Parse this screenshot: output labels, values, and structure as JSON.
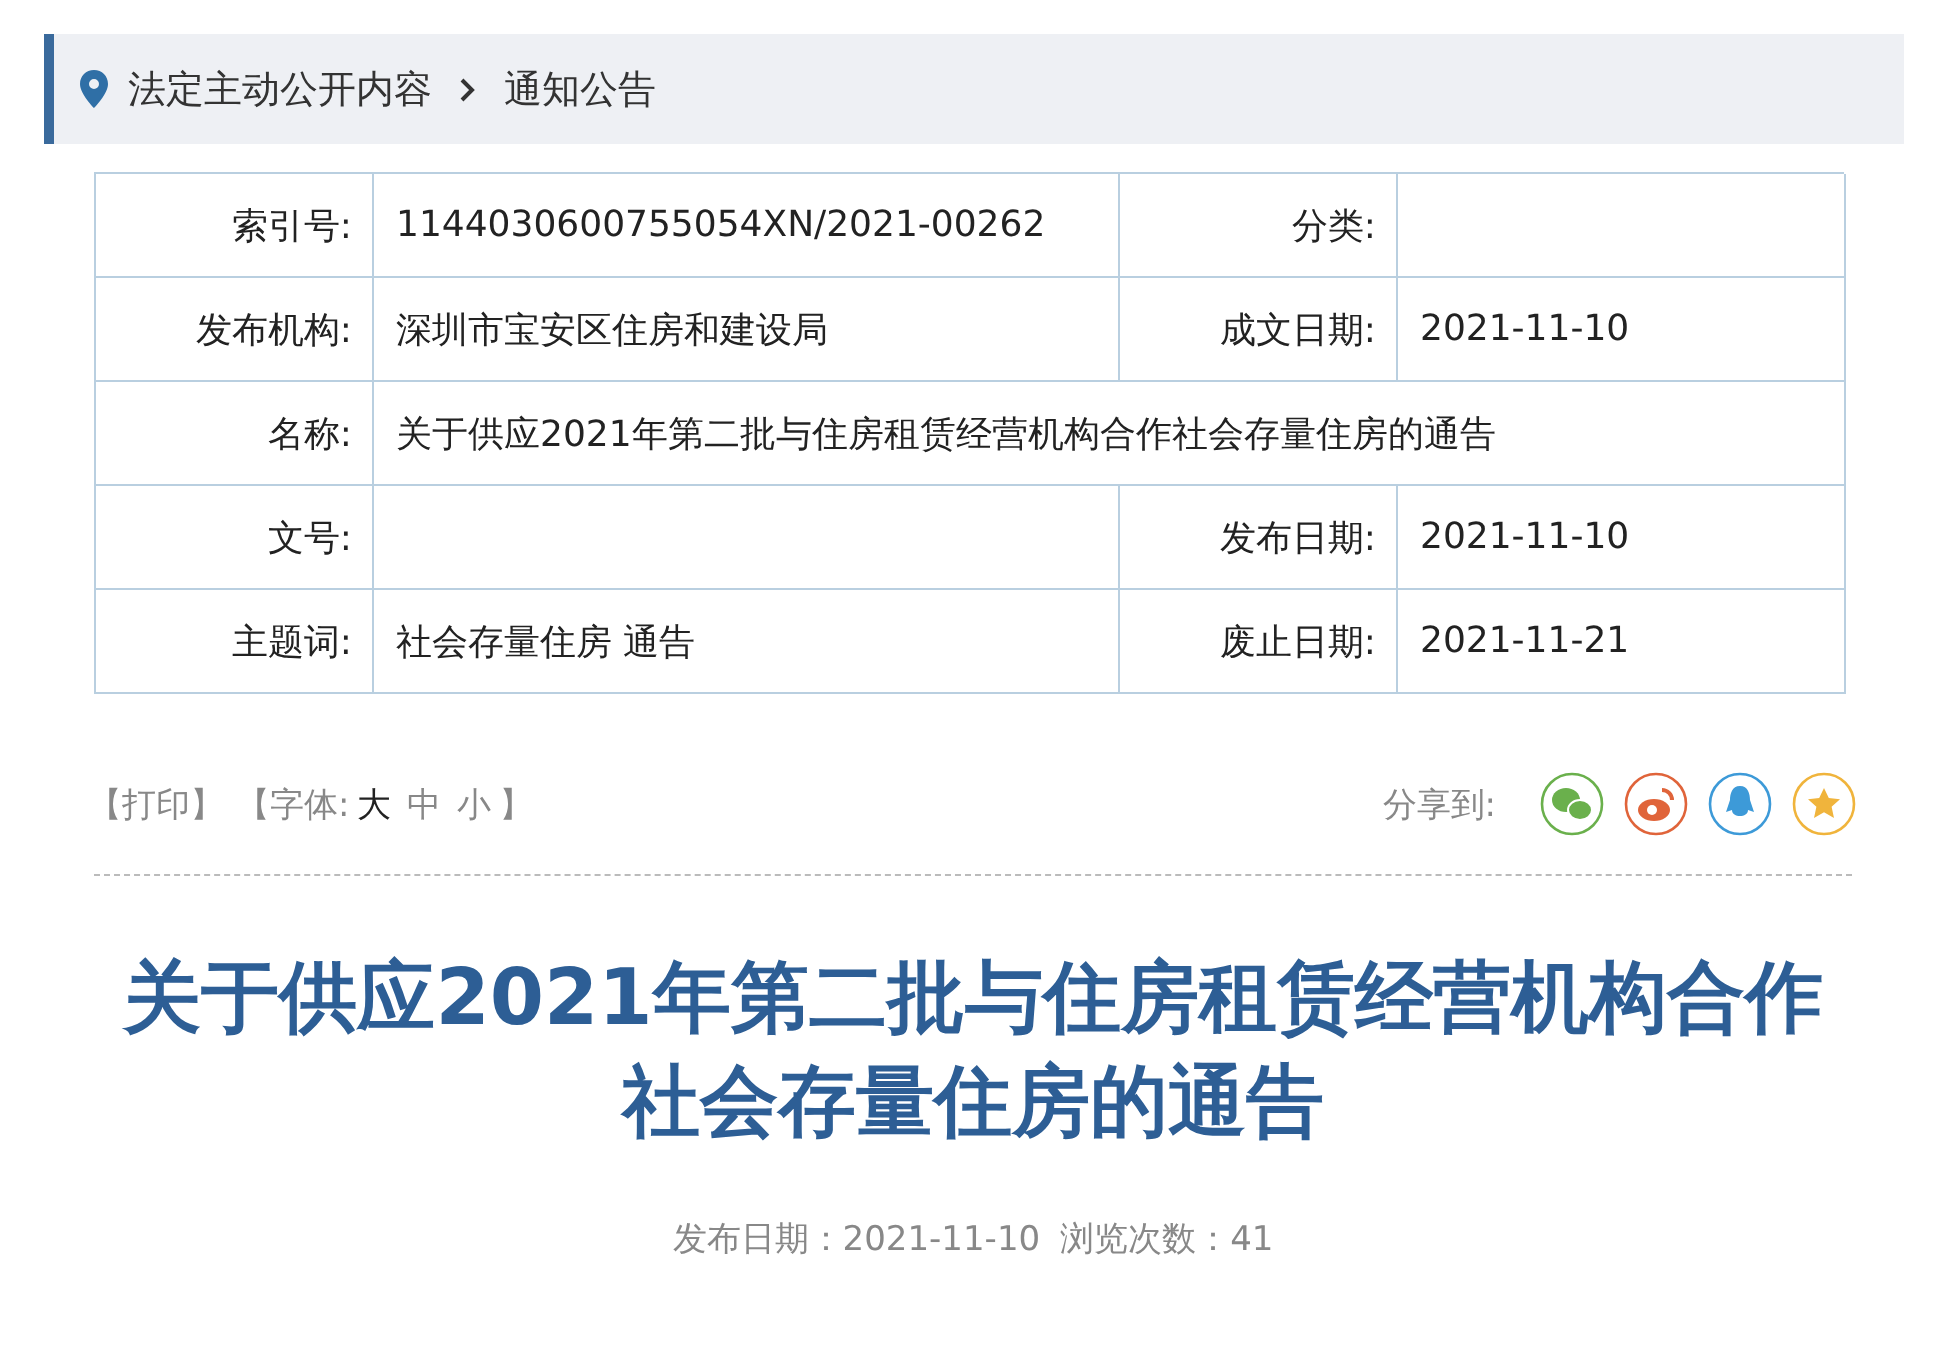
{
  "breadcrumb": {
    "items": [
      "法定主动公开内容",
      "通知公告"
    ]
  },
  "info_table": {
    "rows": [
      {
        "cells": [
          {
            "label": "索引号:",
            "value": "1144030600755054XN/2021-00262"
          },
          {
            "label": "分类:"
          }
        ]
      },
      {
        "cells": [
          {
            "label": "发布机构:",
            "value": "深圳市宝安区住房和建设局"
          },
          {
            "label": "成文日期:",
            "value": "2021-11-10"
          }
        ]
      },
      {
        "cells": [
          {
            "label": "名称:",
            "value": "关于供应2021年第二批与住房租赁经营机构合作社会存量住房的通告"
          }
        ]
      },
      {
        "cells": [
          {
            "label": "文号:"
          },
          {
            "label": "发布日期:",
            "value": "2021-11-10"
          }
        ]
      },
      {
        "cells": [
          {
            "label": "主题词:",
            "value": "社会存量住房 通告"
          },
          {
            "label": "废止日期:",
            "value": "2021-11-21"
          }
        ]
      }
    ]
  },
  "tools": {
    "print": "【打印】",
    "font_size": {
      "prefix": "【字体:",
      "options": [
        {
          "label": "大",
          "selected": true
        },
        {
          "label": "中",
          "selected": false
        },
        {
          "label": "小",
          "selected": false
        }
      ],
      "suffix": "】"
    }
  },
  "share": {
    "label": "分享到:",
    "buttons": [
      {
        "kind": "wechat",
        "color": "#6ab04c"
      },
      {
        "kind": "weibo",
        "color": "#e0643a"
      },
      {
        "kind": "qq",
        "color": "#3d9ad8"
      },
      {
        "kind": "qzone",
        "color": "#f0b43c"
      }
    ]
  },
  "article": {
    "title": "关于供应2021年第二批与住房租赁经营机构合作社会存量住房的通告",
    "published": "发布日期：2021-11-10",
    "views": "浏览次数：41"
  }
}
